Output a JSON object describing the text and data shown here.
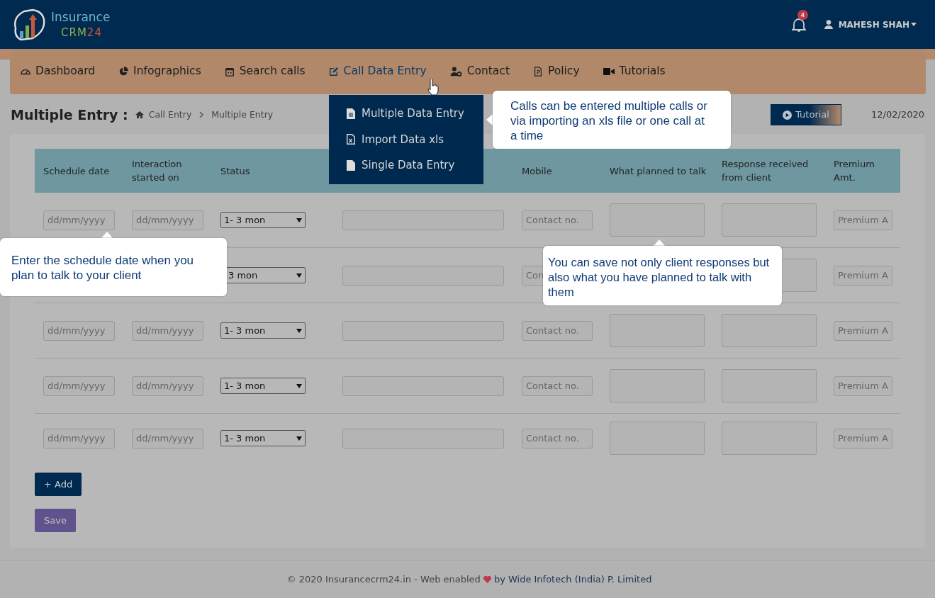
{
  "header": {
    "logo_top": "Insurance",
    "logo_bottom": "CRM",
    "logo_number": "24",
    "notification_count": "4",
    "user_name": "MAHESH SHAH"
  },
  "nav": [
    {
      "label": "Dashboard",
      "selected": false
    },
    {
      "label": "Infographics",
      "selected": false
    },
    {
      "label": "Search calls",
      "selected": false
    },
    {
      "label": "Call Data Entry",
      "selected": true
    },
    {
      "label": "Contact",
      "selected": false
    },
    {
      "label": "Policy",
      "selected": false
    },
    {
      "label": "Tutorials",
      "selected": false
    }
  ],
  "dropdown": [
    {
      "label": "Multiple Data Entry"
    },
    {
      "label": "Import Data xls"
    },
    {
      "label": "Single Data Entry"
    }
  ],
  "page": {
    "title": "Multiple Entry :",
    "breadcrumb": [
      "Call Entry",
      "Multiple Entry"
    ],
    "tutorial_button": "Tutorial",
    "date": "12/02/2020"
  },
  "table": {
    "columns": [
      "Schedule date",
      "Interaction started on",
      "Status",
      null,
      "Mobile",
      "What planned to talk",
      "Response received from client",
      "Premium Amt."
    ],
    "rows": [
      {
        "schedule_date": "dd/mm/yyyy",
        "interaction_started": "dd/mm/yyyy",
        "status": "1- 3 mon",
        "mobile": "Contact no.",
        "premium": "Premium A"
      },
      {
        "status": "3 mon",
        "mobile": "Con",
        "premium": "Premium A"
      },
      {
        "schedule_date": "dd/mm/yyyy",
        "interaction_started": "dd/mm/yyyy",
        "status": "1- 3 mon",
        "mobile": "Contact no.",
        "premium": "Premium A"
      },
      {
        "schedule_date": "dd/mm/yyyy",
        "interaction_started": "dd/mm/yyyy",
        "status": "1- 3 mon",
        "mobile": "Contact no.",
        "premium": "Premium A"
      },
      {
        "schedule_date": "dd/mm/yyyy",
        "interaction_started": "dd/mm/yyyy",
        "status": "1- 3 mon",
        "mobile": "Contact no.",
        "premium": "Premium A"
      }
    ]
  },
  "buttons": {
    "add": "+ Add",
    "save": "Save"
  },
  "callouts": [
    "Calls can be entered multiple calls or via importing an xls file or one call at a time",
    "Enter the schedule date when you plan to talk to your client",
    "You can save not only client responses but also what you have planned to talk with them"
  ],
  "footer": {
    "prefix": "© 2020 Insurancecrm24.in - Web enabled",
    "suffix": "by Wide Infotech (India) P. Limited"
  }
}
